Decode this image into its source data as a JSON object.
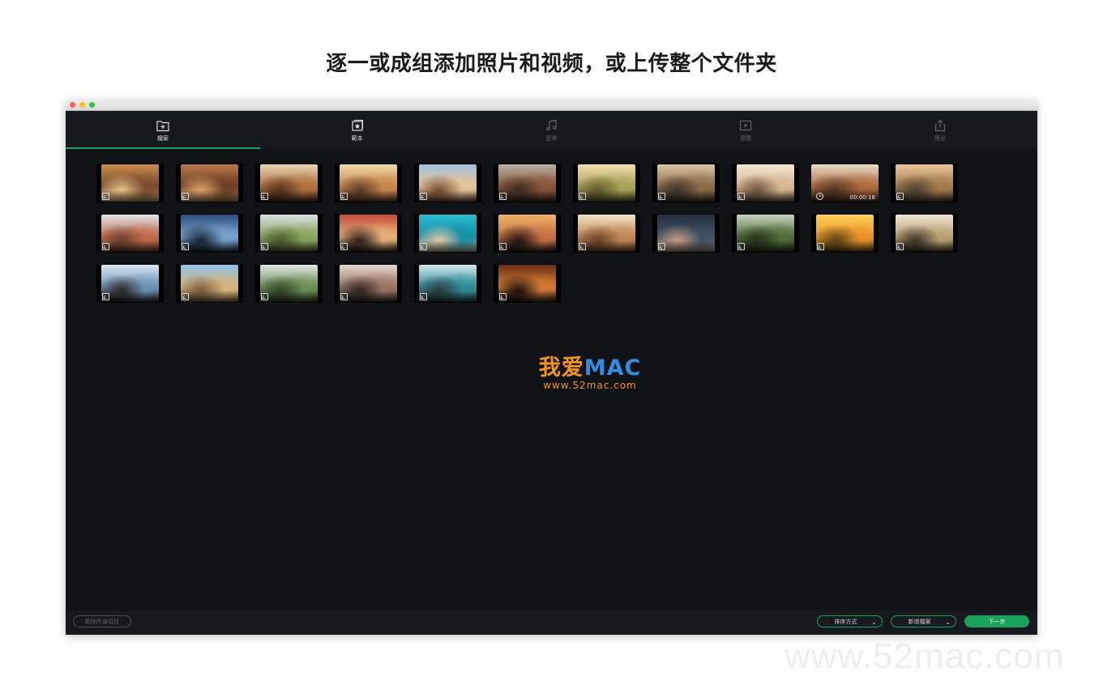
{
  "headline": "逐一或成组添加照片和视频，或上传整个文件夹",
  "tabs": [
    {
      "label": "檔案",
      "icon": "add-folder-icon",
      "active": true
    },
    {
      "label": "範本",
      "icon": "template-star-icon",
      "active": false
    },
    {
      "label": "音樂",
      "icon": "music-note-icon",
      "active": false
    },
    {
      "label": "預覽",
      "icon": "play-preview-icon",
      "active": false
    },
    {
      "label": "匯出",
      "icon": "export-share-icon",
      "active": false
    }
  ],
  "media_rows": [
    [
      {
        "type": "photo",
        "colors": [
          "#c98b4d",
          "#7a4a2c",
          "#e6c38a"
        ]
      },
      {
        "type": "photo",
        "colors": [
          "#b9774a",
          "#6d3e26",
          "#d9a56a"
        ]
      },
      {
        "type": "photo",
        "colors": [
          "#e9d3b0",
          "#b07240",
          "#54301c"
        ]
      },
      {
        "type": "photo",
        "colors": [
          "#f1d9a8",
          "#c7864d",
          "#5c3a25"
        ]
      },
      {
        "type": "photo",
        "colors": [
          "#9fc0dc",
          "#e5c49a",
          "#7a4c33"
        ]
      },
      {
        "type": "photo",
        "colors": [
          "#b8b1a3",
          "#87563a",
          "#3d2a22"
        ]
      },
      {
        "type": "photo",
        "colors": [
          "#f4dfb0",
          "#a8a357",
          "#5d5a2b"
        ]
      },
      {
        "type": "photo",
        "colors": [
          "#d7c5a3",
          "#8e6a4a",
          "#3e342b"
        ]
      },
      {
        "type": "photo",
        "colors": [
          "#f3e7d3",
          "#d6b690",
          "#6e5440"
        ]
      },
      {
        "type": "video",
        "colors": [
          "#e8dcc8",
          "#b06a3d",
          "#4f3424"
        ],
        "duration": "00:00:18"
      },
      {
        "type": "photo",
        "colors": [
          "#e8c79a",
          "#a47b4c",
          "#4c4130"
        ]
      }
    ],
    [
      {
        "type": "photo",
        "colors": [
          "#dfe4ea",
          "#c26b4a",
          "#6b3f30"
        ]
      },
      {
        "type": "photo",
        "colors": [
          "#2c4f7c",
          "#7aa3cf",
          "#152232"
        ]
      },
      {
        "type": "photo",
        "colors": [
          "#d9dfe0",
          "#89a660",
          "#4a5a2e"
        ]
      },
      {
        "type": "photo",
        "colors": [
          "#c44a3a",
          "#e7b27a",
          "#2b1c17"
        ]
      },
      {
        "type": "photo",
        "colors": [
          "#2bbcd0",
          "#168fa6",
          "#e7c9a5"
        ]
      },
      {
        "type": "photo",
        "colors": [
          "#f1b26a",
          "#c57244",
          "#1f1512"
        ]
      },
      {
        "type": "photo",
        "colors": [
          "#f3e1c5",
          "#c28957",
          "#6a4027"
        ]
      },
      {
        "type": "photo",
        "colors": [
          "#26313f",
          "#3e5063",
          "#c49d84"
        ]
      },
      {
        "type": "photo",
        "colors": [
          "#c8d3c0",
          "#4f6d3b",
          "#243019"
        ]
      },
      {
        "type": "photo",
        "colors": [
          "#ffd15a",
          "#e8952a",
          "#5c4412"
        ]
      },
      {
        "type": "photo",
        "colors": [
          "#efe7d6",
          "#b9a173",
          "#3a3326"
        ]
      }
    ],
    [
      {
        "type": "photo",
        "colors": [
          "#d9e7f3",
          "#6d93b5",
          "#2c2622"
        ]
      },
      {
        "type": "photo",
        "colors": [
          "#8fc2e6",
          "#d3b47c",
          "#7a5a3c"
        ]
      },
      {
        "type": "photo",
        "colors": [
          "#dfe6e0",
          "#6b8f57",
          "#324226"
        ]
      },
      {
        "type": "photo",
        "colors": [
          "#e4d7cc",
          "#9a7563",
          "#2f2725"
        ]
      },
      {
        "type": "photo",
        "colors": [
          "#d0e6ec",
          "#2f8c97",
          "#2b3a3d"
        ]
      },
      {
        "type": "photo",
        "colors": [
          "#6b2f17",
          "#d27a33",
          "#1a0f0b"
        ]
      }
    ]
  ],
  "watermark_logo": {
    "cn": "我爱",
    "en": "MAC",
    "url": "www.52mac.com"
  },
  "bottom": {
    "delete_label": "刪除所選項目",
    "sort_label": "排序方式",
    "add_label": "新增檔案",
    "next_label": "下一步"
  },
  "page_watermark": "www.52mac.com",
  "colors": {
    "accent": "#1aa25a",
    "window_bg": "#101215",
    "bar_bg": "#16191e"
  }
}
